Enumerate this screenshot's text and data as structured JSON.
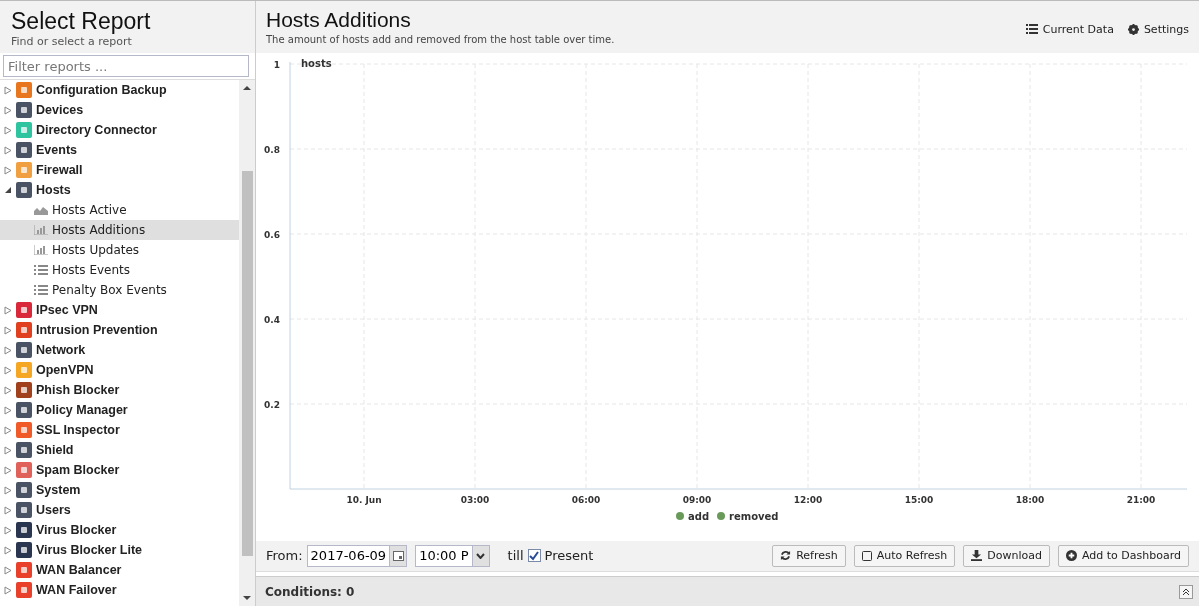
{
  "sidebar": {
    "title": "Select Report",
    "subtitle": "Find or select a report",
    "filter": {
      "placeholder": "Filter reports ..."
    },
    "items": [
      {
        "label": "Configuration Backup",
        "color": "#e8761e",
        "expanded": false
      },
      {
        "label": "Devices",
        "color": "#4a5363",
        "expanded": false
      },
      {
        "label": "Directory Connector",
        "color": "#2fc4a0",
        "expanded": false
      },
      {
        "label": "Events",
        "color": "#4a5363",
        "expanded": false
      },
      {
        "label": "Firewall",
        "color": "#f0a040",
        "expanded": false
      },
      {
        "label": "Hosts",
        "color": "#4a5363",
        "expanded": true,
        "children": [
          {
            "label": "Hosts Active",
            "kind": "area",
            "selected": false
          },
          {
            "label": "Hosts Additions",
            "kind": "bar",
            "selected": true
          },
          {
            "label": "Hosts Updates",
            "kind": "bar",
            "selected": false
          },
          {
            "label": "Hosts Events",
            "kind": "list",
            "selected": false
          },
          {
            "label": "Penalty Box Events",
            "kind": "list",
            "selected": false
          }
        ]
      },
      {
        "label": "IPsec VPN",
        "color": "#d8283a",
        "expanded": false
      },
      {
        "label": "Intrusion Prevention",
        "color": "#e04020",
        "expanded": false
      },
      {
        "label": "Network",
        "color": "#4a5363",
        "expanded": false
      },
      {
        "label": "OpenVPN",
        "color": "#f5a623",
        "expanded": false
      },
      {
        "label": "Phish Blocker",
        "color": "#a0401c",
        "expanded": false
      },
      {
        "label": "Policy Manager",
        "color": "#4a5363",
        "expanded": false
      },
      {
        "label": "SSL Inspector",
        "color": "#f05a28",
        "expanded": false
      },
      {
        "label": "Shield",
        "color": "#4a5363",
        "expanded": false
      },
      {
        "label": "Spam Blocker",
        "color": "#e0605a",
        "expanded": false
      },
      {
        "label": "System",
        "color": "#4a5363",
        "expanded": false
      },
      {
        "label": "Users",
        "color": "#4a5363",
        "expanded": false
      },
      {
        "label": "Virus Blocker",
        "color": "#2a3550",
        "expanded": false
      },
      {
        "label": "Virus Blocker Lite",
        "color": "#2a3550",
        "expanded": false
      },
      {
        "label": "WAN Balancer",
        "color": "#e8402a",
        "expanded": false
      },
      {
        "label": "WAN Failover",
        "color": "#e8402a",
        "expanded": false
      }
    ]
  },
  "report": {
    "title": "Hosts Additions",
    "description": "The amount of hosts add and removed from the host table over time.",
    "actions": [
      {
        "label": "Current Data",
        "kind": "list"
      },
      {
        "label": "Settings",
        "kind": "gear"
      }
    ],
    "chart_data": {
      "type": "line",
      "ylabel": "hosts",
      "x": [
        "10. Jun",
        "03:00",
        "06:00",
        "09:00",
        "12:00",
        "15:00",
        "18:00",
        "21:00"
      ],
      "ylim": [
        0,
        1
      ],
      "grid": true,
      "yticks": [
        0.2,
        0.4,
        0.6,
        0.8,
        1
      ],
      "series": [
        {
          "name": "add",
          "color": "#6a9a5a",
          "values": [
            null,
            null,
            null,
            null,
            null,
            null,
            null,
            null
          ]
        },
        {
          "name": "removed",
          "color": "#6a9a5a",
          "values": [
            null,
            null,
            null,
            null,
            null,
            null,
            null,
            null
          ]
        }
      ]
    }
  },
  "toolbar": {
    "from_label": "From:",
    "date": "2017-06-09",
    "time": "10:00 P",
    "till_label": "till",
    "present": {
      "label": "Present",
      "checked": true
    },
    "buttons": [
      {
        "label": "Refresh",
        "kind": "refresh"
      },
      {
        "label": "Auto Refresh",
        "kind": "checkbox"
      },
      {
        "label": "Download",
        "kind": "download"
      },
      {
        "label": "Add to Dashboard",
        "kind": "add"
      }
    ]
  },
  "conditions": {
    "label": "Conditions: 0"
  }
}
